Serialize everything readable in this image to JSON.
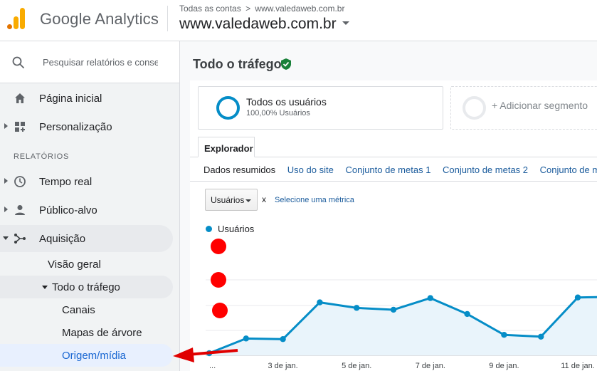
{
  "header": {
    "brand": "Google Analytics",
    "breadcrumb_root": "Todas as contas",
    "breadcrumb_sep": ">",
    "breadcrumb_site": "www.valedaweb.com.br",
    "property": "www.valedaweb.com.br"
  },
  "sidebar": {
    "search_placeholder": "Pesquisar relatórios e conse",
    "home": "Página inicial",
    "custom": "Personalização",
    "section_label": "RELATÓRIOS",
    "realtime": "Tempo real",
    "audience": "Público-alvo",
    "acquisition": "Aquisição",
    "overview": "Visão geral",
    "all_traffic": "Todo o tráfego",
    "channels": "Canais",
    "treemaps": "Mapas de árvore",
    "source_medium": "Origem/mídia"
  },
  "main": {
    "title": "Todo o tráfego",
    "segment_name": "Todos os usuários",
    "segment_sub": "100,00% Usuários",
    "add_segment": "+ Adicionar segmento",
    "tab_explorer": "Explorador",
    "subtabs": [
      "Dados resumidos",
      "Uso do site",
      "Conjunto de metas 1",
      "Conjunto de metas 2",
      "Conjunto de m"
    ],
    "metric": "Usuários",
    "times": "x",
    "select_metric": "Selecione uma métrica",
    "legend": "Usuários"
  },
  "chart_data": {
    "type": "area",
    "color": "#058dc7",
    "x": [
      "1 de jan.",
      "2 de jan.",
      "3 de jan.",
      "4 de jan.",
      "5 de jan.",
      "6 de jan.",
      "7 de jan.",
      "8 de jan.",
      "9 de jan.",
      "10 de jan.",
      "11 de jan.",
      "12 de jan."
    ],
    "x_tick_labels": [
      "...",
      "3 de jan.",
      "5 de jan.",
      "7 de jan.",
      "9 de jan.",
      "11 de jan."
    ],
    "series": [
      {
        "name": "Usuários",
        "values": [
          0.0,
          0.24,
          0.23,
          0.83,
          0.74,
          0.71,
          0.9,
          0.64,
          0.3,
          0.27,
          0.91,
          0.92
        ]
      }
    ],
    "grid": true
  }
}
